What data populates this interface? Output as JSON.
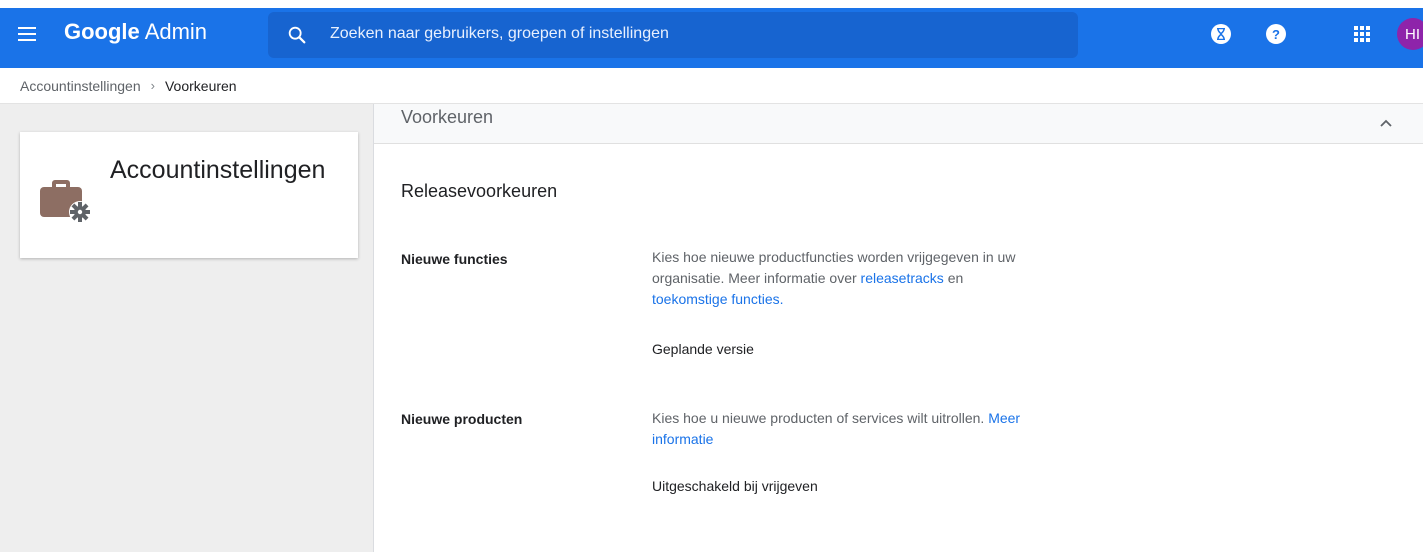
{
  "header": {
    "logo_brand": "Google",
    "logo_product": "Admin",
    "search_placeholder": "Zoeken naar gebruikers, groepen of instellingen",
    "avatar_initials": "HI",
    "colors": {
      "bar": "#1a73e8",
      "avatar": "#8e24aa"
    },
    "icons": [
      "menu-icon",
      "search-icon",
      "hourglass-icon",
      "help-icon",
      "apps-grid-icon"
    ]
  },
  "breadcrumb": {
    "parent": "Accountinstellingen",
    "separator": "›",
    "current": "Voorkeuren"
  },
  "app_card": {
    "title": "Accountinstellingen",
    "icon": "briefcase-gear-icon"
  },
  "section": {
    "title": "Voorkeuren",
    "subtitle": "Releasevoorkeuren",
    "collapse_icon": "chevron-up-icon"
  },
  "settings": [
    {
      "label": "Nieuwe functies",
      "desc_pre": "Kies hoe nieuwe productfuncties worden vrijgegeven in uw organisatie. Meer informatie over",
      "link1": "releasetracks",
      "mid": "en",
      "link2": "toekomstige functies",
      "desc_post": ".",
      "value": "Geplande versie"
    },
    {
      "label": "Nieuwe producten",
      "desc_pre": "Kies hoe u nieuwe producten of services wilt uitrollen.",
      "link1": "Meer informatie",
      "value": "Uitgeschakeld bij vrijgeven"
    }
  ]
}
